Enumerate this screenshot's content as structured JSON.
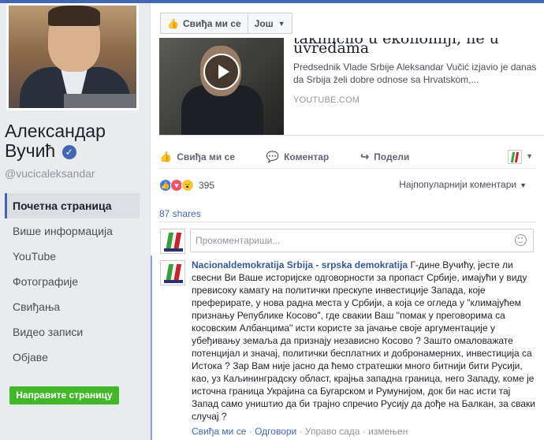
{
  "page": {
    "name": "Александар Вучић",
    "handle": "@vucicaleksandar",
    "verified_icon": "check-icon"
  },
  "nav": {
    "items": [
      {
        "label": "Почетна страница",
        "active": true
      },
      {
        "label": "Више информација"
      },
      {
        "label": "YouTube"
      },
      {
        "label": "Фотографије"
      },
      {
        "label": "Свиђања"
      },
      {
        "label": "Видео записи"
      },
      {
        "label": "Објаве"
      }
    ],
    "create_page": "Направите страницу"
  },
  "toolbar": {
    "like_label": "Свиђа ми се",
    "more_label": "Још"
  },
  "shared_link": {
    "title_line1": "takmičilo u ekonomiji, ne u",
    "title_line2": "uvredama",
    "description": "Predsednik Vlade Srbije Aleksandar Vučić izjavio je danas da Srbija želi dobre odnose sa Hrvatskom,...",
    "source": "YOUTUBE.COM"
  },
  "post_actions": {
    "like": "Свиђа ми се",
    "comment": "Коментар",
    "share": "Подели"
  },
  "reactions": {
    "count": "395",
    "sort_label": "Најпопуларнији коментари"
  },
  "shares": "87 shares",
  "composer": {
    "placeholder": "Прокоментариши..."
  },
  "comment": {
    "author": "Nacionaldemokratija Srbija - srpska demokratija",
    "text": " Г-дине Вучићу, јесте ли свесни Ви Ваше историјске одговорности за пропаст Србије, имајући у виду превисоку камату на политички прескупе инвестиције Запада, које преферирате, у нова радна места у Србији, а која се огледа у \"климајућем признању Републике Косово\", где свакии Ваш \"помак у преговорима са косовским Албанцима\" исти користе за јачање своје аргументације у убеђивању земаља да признају независно Косово ? Зашто омаловажате потенцијал и значај, политички бесплатних и добронамерних, инвестиција са Истока ? Зар Вам није јасно да ћемо стратешки много битнији бити Русији, као, уз Каљининградску област, крајња западна граница, него Западу, коме је источна граница Украјина са Бугарском и Румунијом, док би нас исти тај Запад само уништио да би трајно спречио Русију да дође на Балкан, за сваки случај ?",
    "like": "Свиђа ми се",
    "reply": "Одговори",
    "time": "Управо сада",
    "edited": "измењен"
  },
  "colors": {
    "brand": "#4267b2",
    "create_button": "#42b72a"
  }
}
